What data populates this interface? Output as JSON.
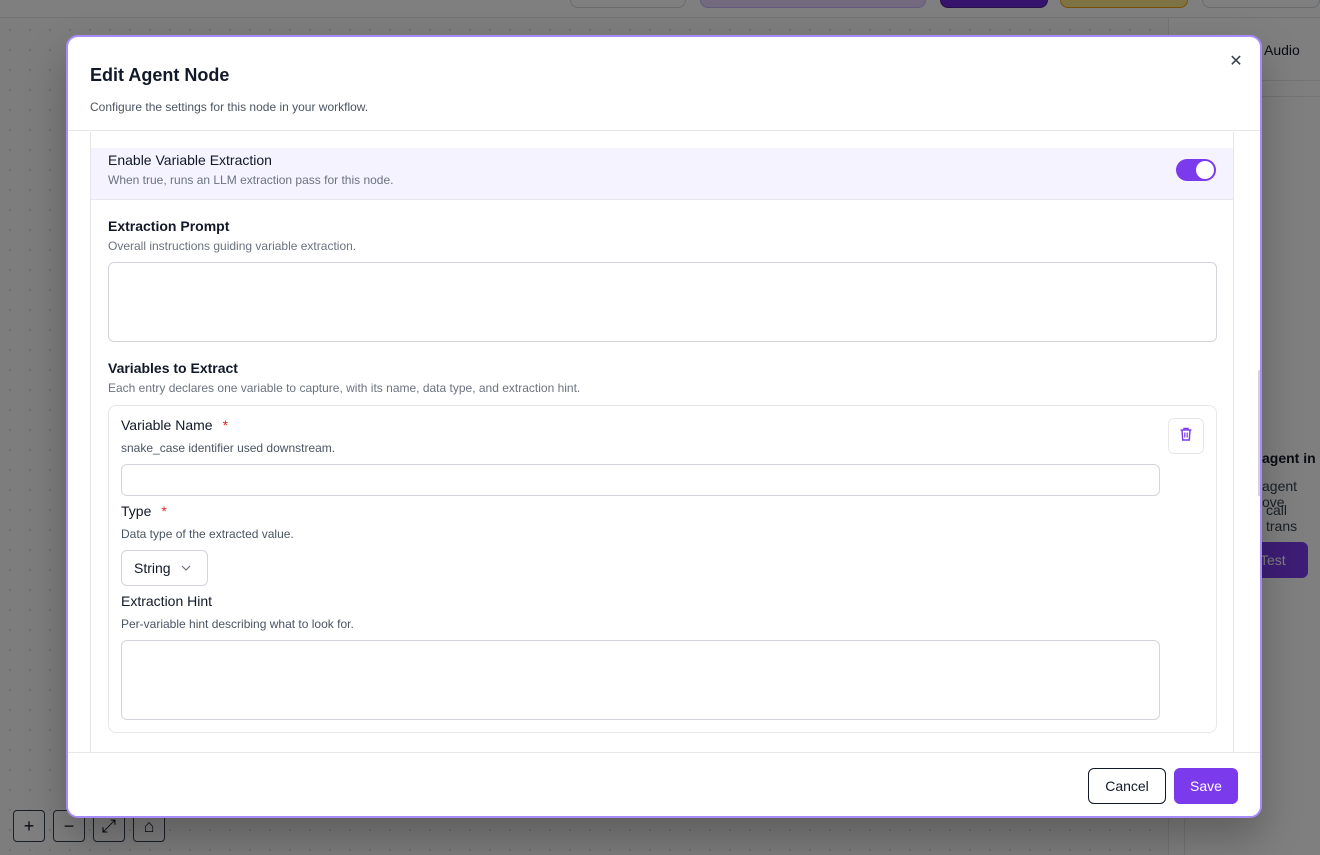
{
  "background": {
    "side_tab_partial": "st Audio",
    "panel_heading_partial": "agent in",
    "panel_line1_partial": "agent ove",
    "panel_line2_partial": "call trans",
    "run_button_partial": "Test",
    "zoom_in_glyph": "+",
    "zoom_out_glyph": "−",
    "fit_glyph": "⤢",
    "lock_glyph": "⌂"
  },
  "modal": {
    "title": "Edit Agent Node",
    "description": "Configure the settings for this node in your workflow.",
    "close_glyph": "✕"
  },
  "variable_extraction": {
    "toggle_label": "Enable Variable Extraction",
    "toggle_help": "When true, runs an LLM extraction pass for this node.",
    "enabled": true,
    "prompt_label": "Extraction Prompt",
    "prompt_help": "Overall instructions guiding variable extraction.",
    "prompt_value": "",
    "variables_label": "Variables to Extract",
    "variables_help": "Each entry declares one variable to capture, with its name, data type, and extraction hint.",
    "variables": [
      {
        "name_label": "Variable Name",
        "name_required": "*",
        "name_help": "snake_case identifier used downstream.",
        "name_value": "",
        "type_label": "Type",
        "type_required": "*",
        "type_help": "Data type of the extracted value.",
        "type_value": "String",
        "hint_label": "Extraction Hint",
        "hint_help": "Per-variable hint describing what to look for.",
        "hint_value": ""
      }
    ]
  },
  "footer": {
    "cancel_label": "Cancel",
    "save_label": "Save"
  },
  "colors": {
    "accent": "#7c3aed",
    "required": "#dc2626"
  }
}
